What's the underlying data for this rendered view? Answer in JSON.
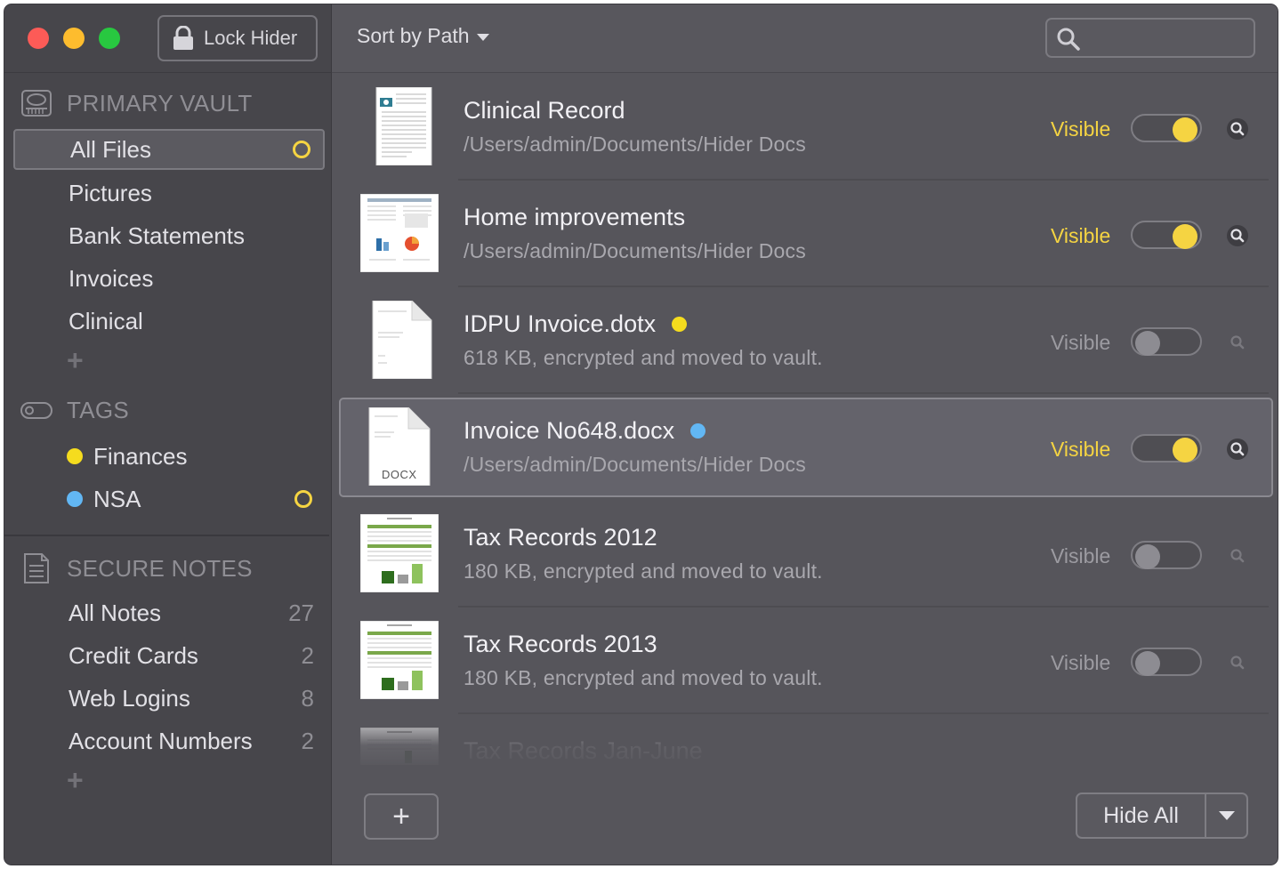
{
  "window": {
    "lock_button": "Lock Hider"
  },
  "sidebar": {
    "vault": {
      "heading": "PRIMARY VAULT",
      "items": [
        {
          "label": "All Files",
          "selected": true,
          "indicator": "ring"
        },
        {
          "label": "Pictures"
        },
        {
          "label": "Bank Statements"
        },
        {
          "label": "Invoices"
        },
        {
          "label": "Clinical"
        }
      ]
    },
    "tags": {
      "heading": "TAGS",
      "items": [
        {
          "label": "Finances",
          "color": "#f5dc1e"
        },
        {
          "label": "NSA",
          "color": "#62b7f4",
          "indicator": "ring"
        }
      ]
    },
    "notes": {
      "heading": "SECURE NOTES",
      "items": [
        {
          "label": "All Notes",
          "count": "27"
        },
        {
          "label": "Credit Cards",
          "count": "2"
        },
        {
          "label": "Web Logins",
          "count": "8"
        },
        {
          "label": "Account Numbers",
          "count": "2"
        }
      ]
    }
  },
  "toolbar": {
    "sort_label": "Sort by Path",
    "search_placeholder": ""
  },
  "files": [
    {
      "name": "Clinical Record",
      "detail": "/Users/admin/Documents/Hider Docs",
      "visibility": "Visible",
      "visible": true,
      "thumb": "form-icon"
    },
    {
      "name": "Home improvements",
      "detail": "/Users/admin/Documents/Hider Docs",
      "visibility": "Visible",
      "visible": true,
      "thumb": "report-icon"
    },
    {
      "name": "IDPU Invoice.dotx",
      "detail": "618 KB, encrypted and moved to vault.",
      "visibility": "Visible",
      "visible": false,
      "tag_color": "#f5dc1e",
      "thumb": "document-icon"
    },
    {
      "name": "Invoice No648.docx",
      "detail": "/Users/admin/Documents/Hider Docs",
      "visibility": "Visible",
      "visible": true,
      "tag_color": "#62b7f4",
      "selected": true,
      "thumb": "docx-icon",
      "thumb_label": "DOCX"
    },
    {
      "name": "Tax Records 2012",
      "detail": "180 KB, encrypted and moved to vault.",
      "visibility": "Visible",
      "visible": false,
      "thumb": "spreadsheet-icon"
    },
    {
      "name": "Tax Records 2013",
      "detail": "180 KB, encrypted and moved to vault.",
      "visibility": "Visible",
      "visible": false,
      "thumb": "spreadsheet-icon"
    },
    {
      "name": "Tax Records Jan-June",
      "detail": "",
      "visibility": "",
      "visible": false,
      "thumb": "spreadsheet-icon"
    }
  ],
  "footer": {
    "add_label": "+",
    "hide_all_label": "Hide All"
  },
  "colors": {
    "accent": "#f5d442",
    "window_bg": "#56555b",
    "sidebar_bg": "#47464b"
  }
}
